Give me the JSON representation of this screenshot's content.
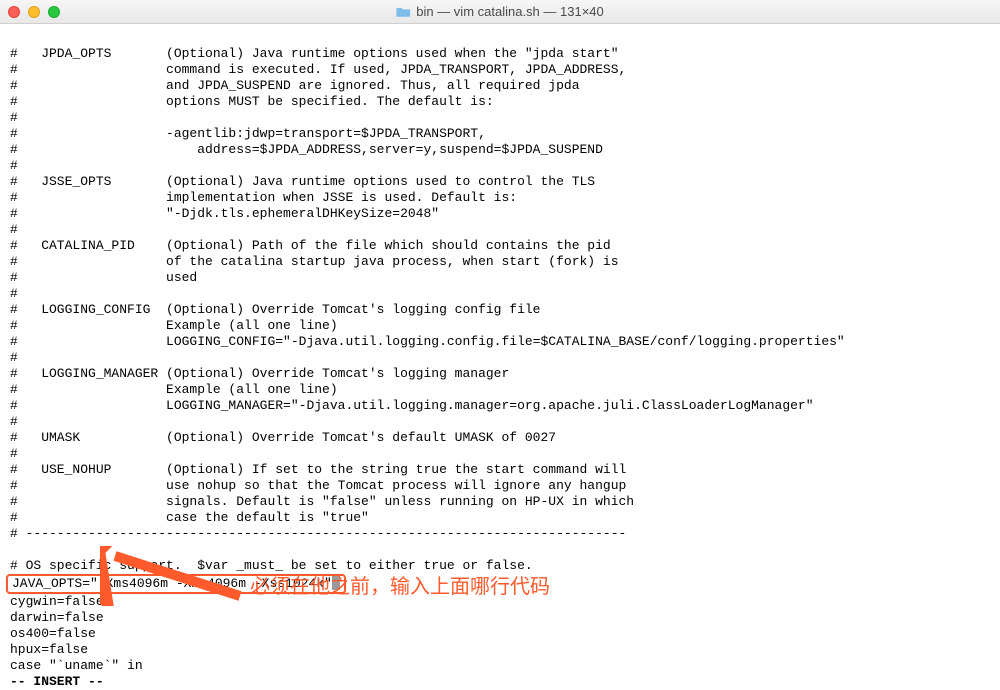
{
  "window": {
    "title": "bin — vim catalina.sh — 131×40"
  },
  "lines": {
    "l0": "#   JPDA_OPTS       (Optional) Java runtime options used when the \"jpda start\"",
    "l1": "#                   command is executed. If used, JPDA_TRANSPORT, JPDA_ADDRESS,",
    "l2": "#                   and JPDA_SUSPEND are ignored. Thus, all required jpda",
    "l3": "#                   options MUST be specified. The default is:",
    "l4": "#",
    "l5": "#                   -agentlib:jdwp=transport=$JPDA_TRANSPORT,",
    "l6": "#                       address=$JPDA_ADDRESS,server=y,suspend=$JPDA_SUSPEND",
    "l7": "#",
    "l8": "#   JSSE_OPTS       (Optional) Java runtime options used to control the TLS",
    "l9": "#                   implementation when JSSE is used. Default is:",
    "l10": "#                   \"-Djdk.tls.ephemeralDHKeySize=2048\"",
    "l11": "#",
    "l12": "#   CATALINA_PID    (Optional) Path of the file which should contains the pid",
    "l13": "#                   of the catalina startup java process, when start (fork) is",
    "l14": "#                   used",
    "l15": "#",
    "l16": "#   LOGGING_CONFIG  (Optional) Override Tomcat's logging config file",
    "l17": "#                   Example (all one line)",
    "l18": "#                   LOGGING_CONFIG=\"-Djava.util.logging.config.file=$CATALINA_BASE/conf/logging.properties\"",
    "l19": "#",
    "l20": "#   LOGGING_MANAGER (Optional) Override Tomcat's logging manager",
    "l21": "#                   Example (all one line)",
    "l22": "#                   LOGGING_MANAGER=\"-Djava.util.logging.manager=org.apache.juli.ClassLoaderLogManager\"",
    "l23": "#",
    "l24": "#   UMASK           (Optional) Override Tomcat's default UMASK of 0027",
    "l25": "#",
    "l26": "#   USE_NOHUP       (Optional) If set to the string true the start command will",
    "l27": "#                   use nohup so that the Tomcat process will ignore any hangup",
    "l28": "#                   signals. Default is \"false\" unless running on HP-UX in which",
    "l29": "#                   case the default is \"true\"",
    "l30": "# -----------------------------------------------------------------------------",
    "l31": "",
    "l32": "# OS specific support.  $var _must_ be set to either true or false.",
    "highlighted": "JAVA_OPTS=\"-Xms4096m -Xmx4096m -Xss1024k\"",
    "l34": "cygwin=false",
    "l35": "darwin=false",
    "l36": "os400=false",
    "l37": "hpux=false",
    "l38": "case \"`uname`\" in",
    "mode": "-- INSERT --"
  },
  "annotation": "必须在他之前，输入上面哪行代码",
  "colors": {
    "accent": "#ff5a2b"
  }
}
